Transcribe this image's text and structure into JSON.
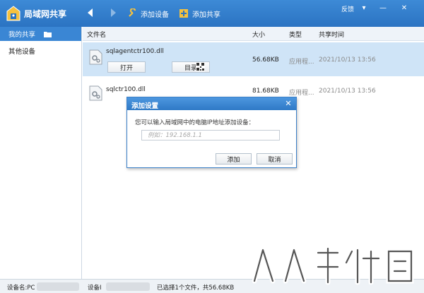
{
  "window": {
    "title": "局域网共享",
    "feedback": "反馈",
    "menu_glyph": "▾",
    "minimize_glyph": "—",
    "close_glyph": "✕"
  },
  "toolbar": {
    "add_device": "添加设备",
    "add_share": "添加共享"
  },
  "sidebar": {
    "items": [
      {
        "label": "我的共享",
        "active": true
      },
      {
        "label": "其他设备",
        "active": false
      }
    ]
  },
  "list": {
    "columns": {
      "name": "文件名",
      "size": "大小",
      "type": "类型",
      "time": "共享时间"
    },
    "rows": [
      {
        "name": "sqlagentctr100.dll",
        "size": "56.68KB",
        "type": "应用程...",
        "time": "2021/10/13 13:56",
        "open_label": "打开",
        "dir_label": "目录"
      },
      {
        "name": "sqlctr100.dll",
        "size": "81.68KB",
        "type": "应用程...",
        "time": "2021/10/13 13:56"
      }
    ]
  },
  "dialog": {
    "title": "添加设置",
    "prompt": "您可以输入局域网中的电脑IP地址添加设备：",
    "input_value": "",
    "input_placeholder": "例如：192.168.1.1",
    "add_label": "添加",
    "cancel_label": "取消"
  },
  "statusbar": {
    "device_name_label": "设备名:PC",
    "device_ip_label": "设备I",
    "selection": "已选择1个文件，共56.68KB"
  },
  "colors": {
    "titlebar": "#2f7bc9",
    "accent": "#3a86d4",
    "selected_row": "#cfe4f7"
  }
}
